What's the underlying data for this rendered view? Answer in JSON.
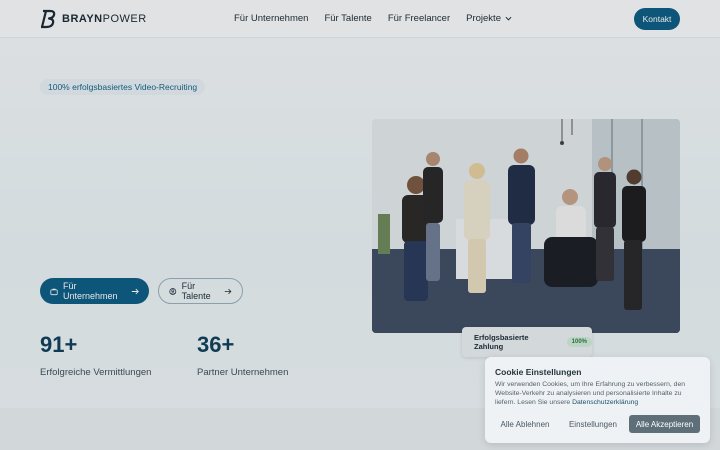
{
  "header": {
    "brand_bold": "BRAYN",
    "brand_light": "POWER",
    "nav": [
      {
        "label": "Für Unternehmen"
      },
      {
        "label": "Für Talente"
      },
      {
        "label": "Für Freelancer"
      },
      {
        "label": "Projekte"
      }
    ],
    "contact_label": "Kontakt"
  },
  "hero": {
    "tag": "100% erfolgsbasiertes Video-Recruiting",
    "primary_button": "Für Unternehmen",
    "secondary_button": "Für Talente"
  },
  "stats": [
    {
      "value": "91+",
      "label": "Erfolgreiche Vermittlungen"
    },
    {
      "value": "36+",
      "label": "Partner Unternehmen"
    }
  ],
  "badge": {
    "label": "Erfolgsbasierte Zahlung",
    "pill": "100%"
  },
  "cookie": {
    "title": "Cookie Einstellungen",
    "text": "Wir verwenden Cookies, um Ihre Erfahrung zu verbessern, den Website-Verkehr zu analysieren und personalisierte Inhalte zu liefern. Lesen Sie unsere",
    "link": "Datenschutzerklärung",
    "deny": "Alle Ablehnen",
    "settings": "Einstellungen",
    "accept": "Alle Akzeptieren"
  },
  "colors": {
    "brand": "#0f5f85",
    "stat": "#11425d"
  }
}
